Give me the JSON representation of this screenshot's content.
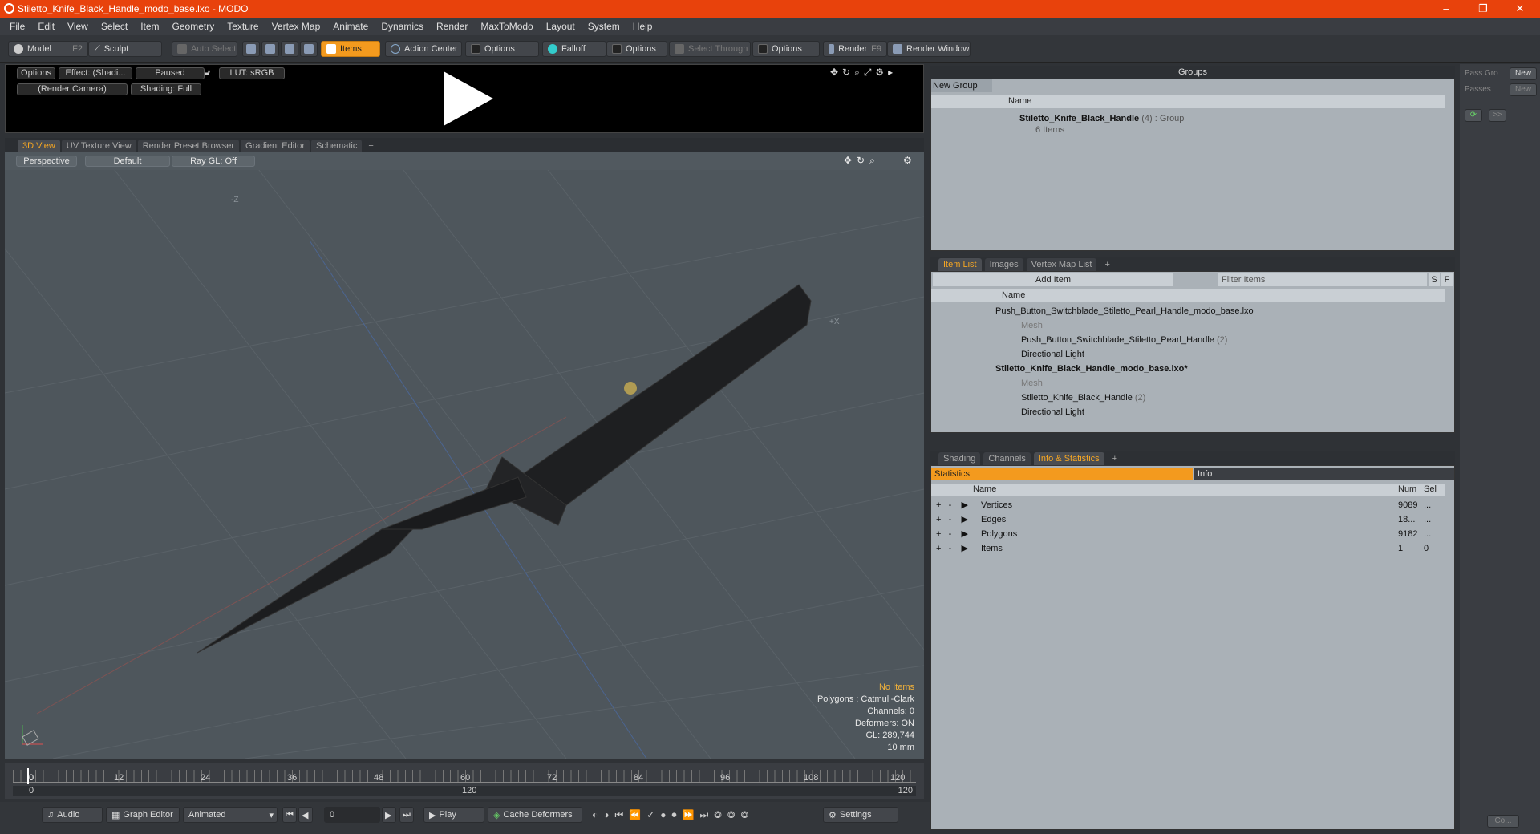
{
  "window": {
    "title": "Stiletto_Knife_Black_Handle_modo_base.lxo - MODO",
    "controls": [
      "–",
      "❐",
      "✕"
    ]
  },
  "menu": [
    "File",
    "Edit",
    "View",
    "Select",
    "Item",
    "Geometry",
    "Texture",
    "Vertex Map",
    "Animate",
    "Dynamics",
    "Render",
    "MaxToModo",
    "Layout",
    "System",
    "Help"
  ],
  "toolbar": {
    "model": "Model",
    "model_key": "F2",
    "sculpt": "Sculpt",
    "auto_select": "Auto Select",
    "items": "Items",
    "action_center": "Action Center",
    "options1": "Options",
    "falloff": "Falloff",
    "options2": "Options",
    "select_through": "Select Through",
    "options3": "Options",
    "render": "Render",
    "render_key": "F9",
    "render_window": "Render Window"
  },
  "render_preview": {
    "options": "Options",
    "effect": "Effect: (Shadi...",
    "paused": "Paused",
    "lut": "LUT: sRGB",
    "camera": "(Render Camera)",
    "shading": "Shading: Full"
  },
  "view_tabs": [
    "3D View",
    "UV Texture View",
    "Render Preset Browser",
    "Gradient Editor",
    "Schematic",
    "+"
  ],
  "viewport": {
    "perspective": "Perspective",
    "default": "Default",
    "raygl": "Ray GL: Off",
    "axis_minus_z": "-Z",
    "axis_x": "+X",
    "stats": {
      "no_items": "No Items",
      "polygons": "Polygons : Catmull-Clark",
      "channels": "Channels: 0",
      "deformers": "Deformers: ON",
      "gl": "GL: 289,744",
      "unit": "10 mm"
    }
  },
  "timeline": {
    "ticks": [
      "0",
      "12",
      "24",
      "36",
      "48",
      "60",
      "72",
      "84",
      "96",
      "108",
      "120"
    ],
    "start": "0",
    "mid": "120",
    "end": "120"
  },
  "bottom": {
    "audio": "Audio",
    "graph_editor": "Graph Editor",
    "animated": "Animated",
    "frame": "0",
    "play": "Play",
    "cache": "Cache Deformers",
    "settings": "Settings"
  },
  "groups": {
    "header": "Groups",
    "new_group": "New Group",
    "col_name": "Name",
    "item_name": "Stiletto_Knife_Black_Handle",
    "item_count": "(4)",
    "item_type": ": Group",
    "item_sub": "6 Items"
  },
  "item_list": {
    "tabs": [
      "Item List",
      "Images",
      "Vertex Map List",
      "+"
    ],
    "add_item": "Add Item",
    "filter": "Filter Items",
    "s": "S",
    "f": "F",
    "col_name": "Name",
    "rows": [
      {
        "text": "Push_Button_Switchblade_Stiletto_Pearl_Handle_modo_base.lxo",
        "indent": 0,
        "bold": false
      },
      {
        "text": "Mesh",
        "indent": 1,
        "dim": true
      },
      {
        "text": "Push_Button_Switchblade_Stiletto_Pearl_Handle",
        "suffix": "(2)",
        "indent": 1
      },
      {
        "text": "Directional Light",
        "indent": 1
      },
      {
        "text": "Stiletto_Knife_Black_Handle_modo_base.lxo*",
        "indent": 0,
        "bold": true
      },
      {
        "text": "Mesh",
        "indent": 1,
        "dim": true
      },
      {
        "text": "Stiletto_Knife_Black_Handle",
        "suffix": "(2)",
        "indent": 1
      },
      {
        "text": "Directional Light",
        "indent": 1
      }
    ]
  },
  "info": {
    "tabs": [
      "Shading",
      "Channels",
      "Info & Statistics",
      "+"
    ],
    "statistics": "Statistics",
    "info": "Info",
    "cols": {
      "name": "Name",
      "num": "Num",
      "sel": "Sel"
    },
    "rows": [
      {
        "name": "Vertices",
        "num": "9089",
        "sel": "..."
      },
      {
        "name": "Edges",
        "num": "18...",
        "sel": "..."
      },
      {
        "name": "Polygons",
        "num": "9182",
        "sel": "..."
      },
      {
        "name": "Items",
        "num": "1",
        "sel": "0"
      }
    ]
  },
  "right_panel": {
    "pass_group": "Pass Gro",
    "new1": "New",
    "passes": "Passes",
    "new2": "New",
    "co": "Co..."
  },
  "colors": {
    "title_bar": "#e8420c",
    "accent": "#f39a1e",
    "viewport": "#4e565c"
  }
}
